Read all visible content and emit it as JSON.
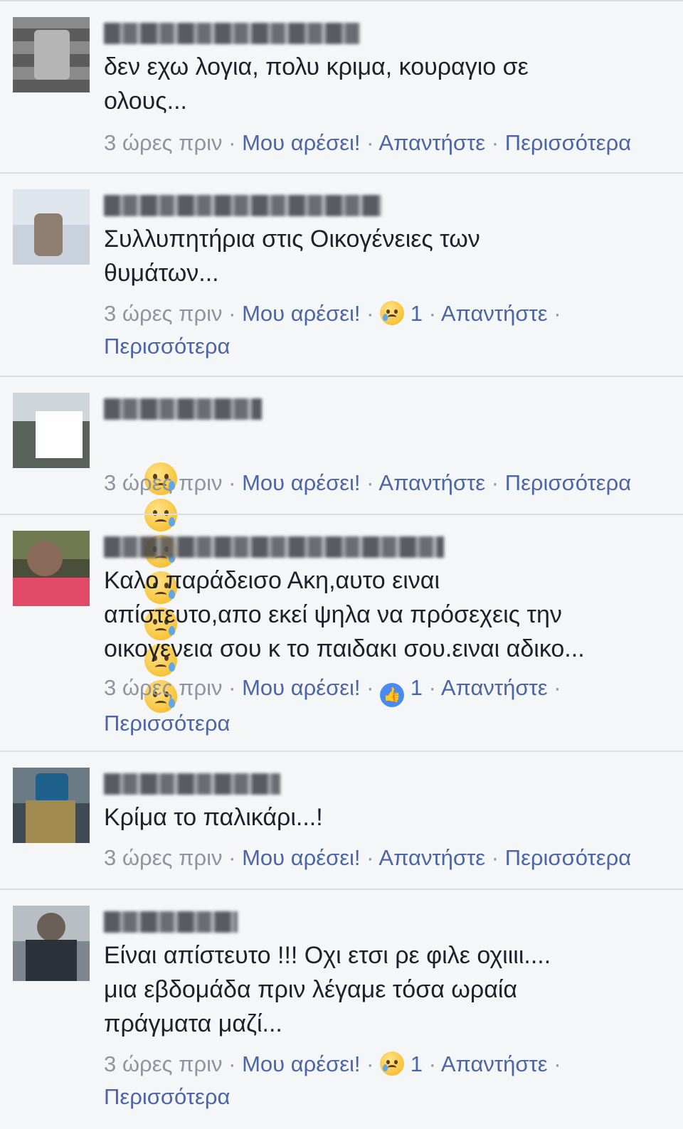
{
  "comments": [
    {
      "body": "δεν εχω λογια, πολυ κριμα, κουραγιο σε\nολους...",
      "time": "3 ώρες πριν",
      "like": "Μου αρέσει!",
      "reply": "Απαντήστε",
      "more": "Περισσότερα",
      "reaction_icon": null,
      "reaction_count": null
    },
    {
      "body": "Συλλυπητήρια στις Οικογένειες των\nθυμάτων...",
      "time": "3 ώρες πριν",
      "like": "Μου αρέσει!",
      "reply": "Απαντήστε",
      "more": "Περισσότερα",
      "reaction_icon": "sad-face-icon",
      "reaction_count": "1"
    },
    {
      "body": "😢😢😢😢😢😢😢",
      "time": "3 ώρες πριν",
      "like": "Μου αρέσει!",
      "reply": "Απαντήστε",
      "more": "Περισσότερα",
      "reaction_icon": null,
      "reaction_count": null
    },
    {
      "body": "Καλο παράδεισο Ακη,αυτο ειναι\nαπίστευτο,απο εκεί ψηλα να πρόσεχεις την\nοικογενεια σου κ το παιδακι σου.ειναι αδικο...",
      "time": "3 ώρες πριν",
      "like": "Μου αρέσει!",
      "reply": "Απαντήστε",
      "more": "Περισσότερα",
      "reaction_icon": "thumbs-up-icon",
      "reaction_count": "1"
    },
    {
      "body": "Κρίμα το παλικάρι...!",
      "time": "3 ώρες πριν",
      "like": "Μου αρέσει!",
      "reply": "Απαντήστε",
      "more": "Περισσότερα",
      "reaction_icon": null,
      "reaction_count": null
    },
    {
      "body": "Είναι απίστευτο !!! Οχι ετσι ρε φιλε οχιιιι....\nμια εβδομάδα πριν λέγαμε τόσα ωραία\nπράγματα μαζί...",
      "time": "3 ώρες πριν",
      "like": "Μου αρέσει!",
      "reply": "Απαντήστε",
      "more": "Περισσότερα",
      "reaction_icon": "sad-face-icon",
      "reaction_count": "1"
    }
  ],
  "separator": "·",
  "colors": {
    "background": "#f5f6f8",
    "link": "#4b66a6",
    "meta": "#90949c",
    "text": "#1d2129",
    "like_blue": "#4a8af4"
  }
}
